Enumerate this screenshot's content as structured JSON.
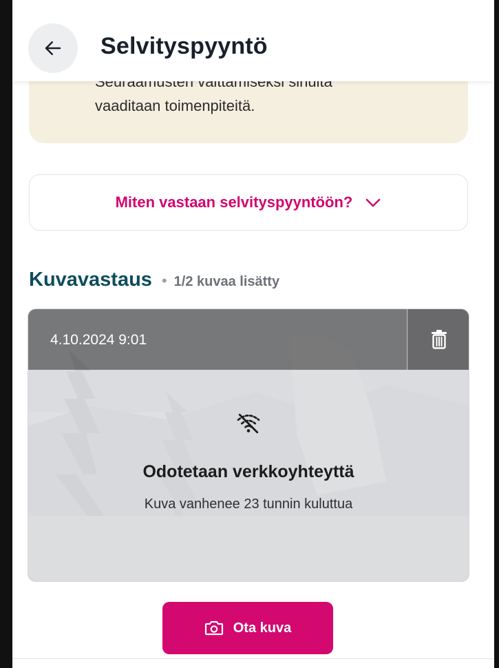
{
  "header": {
    "title": "Selvityspyyntö",
    "back_icon": "arrow-left-icon"
  },
  "notice": {
    "partial_line": "Seuraamusten välttämiseksi sinulta",
    "text": "vaaditaan toimenpiteitä."
  },
  "howto": {
    "label": "Miten vastaan selvityspyyntöön?",
    "icon": "chevron-down-icon"
  },
  "section": {
    "title": "Kuvavastaus",
    "count": "1/2 kuvaa lisätty"
  },
  "photo": {
    "timestamp": "4.10.2024 9:01",
    "delete_icon": "trash-icon",
    "status_icon": "wifi-off-icon",
    "status_title": "Odotetaan verkkoyhteyttä",
    "status_subtitle": "Kuva vanhenee 23 tunnin kuluttua"
  },
  "actions": {
    "camera_label": "Ota kuva",
    "camera_icon": "camera-icon"
  },
  "colors": {
    "brand_pink": "#d3096f",
    "heading_teal": "#0e4c5c",
    "notice_bg": "#f5efdf"
  }
}
